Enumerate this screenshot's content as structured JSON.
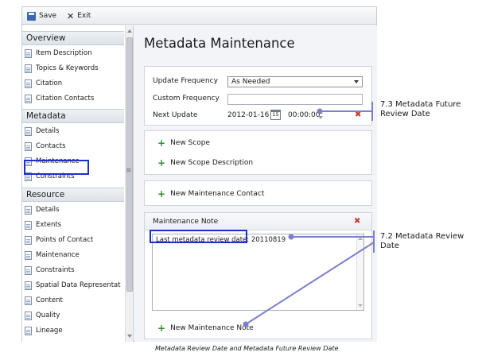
{
  "toolbar": {
    "save_label": "Save",
    "exit_label": "Exit"
  },
  "sidebar": {
    "sections": [
      {
        "title": "Overview",
        "items": [
          "Item Description",
          "Topics & Keywords",
          "Citation",
          "Citation Contacts"
        ]
      },
      {
        "title": "Metadata",
        "items": [
          "Details",
          "Contacts",
          "Maintenance",
          "Constraints"
        ]
      },
      {
        "title": "Resource",
        "items": [
          "Details",
          "Extents",
          "Points of Contact",
          "Maintenance",
          "Constraints",
          "Spatial Data Representat",
          "Content",
          "Quality",
          "Lineage"
        ]
      }
    ],
    "highlighted_item": "Maintenance"
  },
  "main": {
    "title": "Metadata Maintenance",
    "update_frequency": {
      "label": "Update Frequency",
      "value": "As Needed"
    },
    "custom_frequency": {
      "label": "Custom Frequency",
      "value": ""
    },
    "next_update": {
      "label": "Next Update",
      "date": "2012-01-16",
      "calendar_day": "15",
      "time": "00:00:00"
    },
    "scope_actions": [
      "New Scope",
      "New Scope Description"
    ],
    "contact_action": "New Maintenance Contact",
    "note": {
      "header": "Maintenance Note",
      "label": "Last metadata review date:",
      "value": "20110819",
      "add_action": "New Maintenance Note"
    }
  },
  "annotations": {
    "future_review": "7.3 Metadata Future Review Date",
    "review": "7.2 Metadata Review Date",
    "color": "#7d7fc8"
  },
  "caption": "Metadata Review Date and Metadata Future Review Date"
}
